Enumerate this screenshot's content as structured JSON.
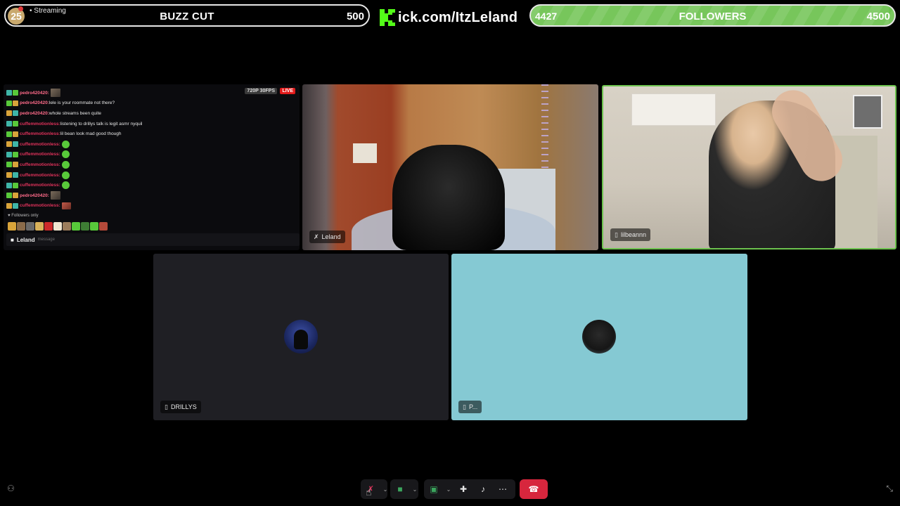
{
  "overlay": {
    "subgoal": {
      "badge": "25",
      "status": "Streaming",
      "title": "BUZZ CUT",
      "target": "500"
    },
    "kick": {
      "url": "ick.com/ItzLeland",
      "brand_color": "#53fc18"
    },
    "followers": {
      "current": "4427",
      "title": "FOLLOWERS",
      "target": "4500",
      "progress_fraction": 0.984,
      "bar_color": "#6cc24e"
    }
  },
  "chat": {
    "quality": "720P 30FPS",
    "live_label": "LIVE",
    "messages": [
      {
        "user": "pedro420420:",
        "text": "",
        "user_color": "#ff6b8a",
        "emote": "img"
      },
      {
        "user": "pedro420420:",
        "text": "lele is your roommate not there?",
        "user_color": "#ff6b8a",
        "emote": ""
      },
      {
        "user": "pedro420420:",
        "text": "whole streams been quite",
        "user_color": "#ff6b8a",
        "emote": ""
      },
      {
        "user": "cuffemmotionless:",
        "text": "listening to drillys talk is legit asmr nyquil",
        "user_color": "#e0325b",
        "emote": ""
      },
      {
        "user": "cuffemmotionless:",
        "text": "lil bean look mad good though",
        "user_color": "#e0325b",
        "emote": ""
      },
      {
        "user": "cuffemmotionless:",
        "text": "",
        "user_color": "#e0325b",
        "emote": "green"
      },
      {
        "user": "cuffemmotionless:",
        "text": "",
        "user_color": "#e0325b",
        "emote": "green"
      },
      {
        "user": "cuffemmotionless:",
        "text": "",
        "user_color": "#e0325b",
        "emote": "green"
      },
      {
        "user": "cuffemmotionless:",
        "text": "",
        "user_color": "#e0325b",
        "emote": "green"
      },
      {
        "user": "cuffemmotionless:",
        "text": "",
        "user_color": "#e0325b",
        "emote": "green"
      },
      {
        "user": "pedro420420:",
        "text": "",
        "user_color": "#ff6b8a",
        "emote": "img"
      },
      {
        "user": "cuffemmotionless:",
        "text": "",
        "user_color": "#e0325b",
        "emote": "img2"
      }
    ],
    "followers_only": "Followers only",
    "input_name": "Leland",
    "input_placeholder": "message"
  },
  "participants": {
    "leland": {
      "name": "Leland",
      "icon": "mic-muted-icon"
    },
    "lilbeannn": {
      "name": "lilbeannn",
      "icon": "phone-icon",
      "speaking_color": "#6cc24e"
    },
    "drillys": {
      "name": "DRILLYS",
      "icon": "phone-icon"
    },
    "p": {
      "name": "P...",
      "icon": "phone-icon",
      "bg_color": "#85c9d3"
    }
  },
  "toolbar": {
    "mic": "mic-muted-icon",
    "camera": "camera-icon",
    "screenshare": "screenshare-icon",
    "activities": "activities-icon",
    "soundboard": "soundboard-icon",
    "more": "more-icon",
    "leave": "leave-call-icon",
    "leave_color": "#d7263d"
  }
}
